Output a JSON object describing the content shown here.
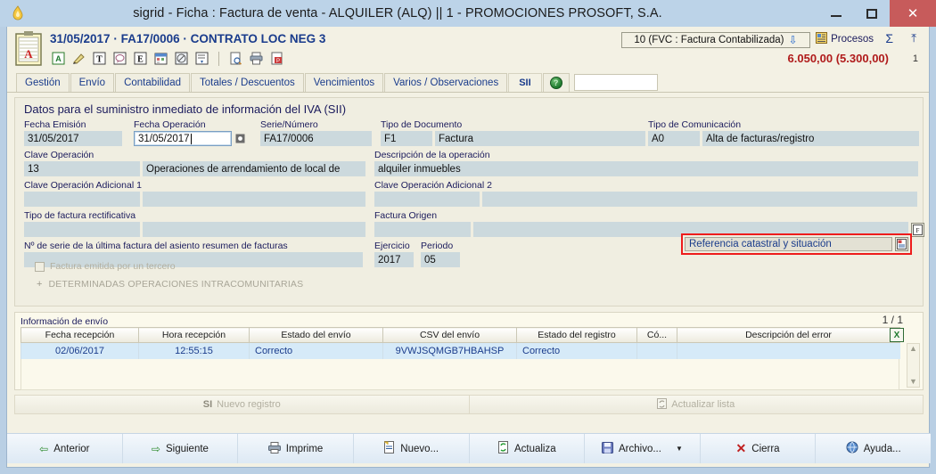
{
  "window": {
    "title": "sigrid - Ficha : Factura de venta - ALQUILER (ALQ) || 1 - PROMOCIONES PROSOFT, S.A.",
    "app_icon": "flame-icon",
    "minimize_label": "–",
    "maximize_label": "□",
    "close_label": "✕"
  },
  "header": {
    "doc_icon": "clipboard-icon",
    "doc_title": "31/05/2017 · FA17/0006 · CONTRATO LOC NEG 3",
    "status_value": "10 (FVC : Factura Contabilizada)",
    "status_arrow": "⇓",
    "procesos_label": "Procesos",
    "sigma_label": "Σ",
    "pin_label": "⤒",
    "amount": "6.050,00 (5.300,00)",
    "amount_count": "1",
    "toolbar_icons": [
      {
        "name": "accent-a-icon",
        "glyph": "A"
      },
      {
        "name": "pencil-icon",
        "glyph": "✎"
      },
      {
        "name": "text-tool-icon",
        "glyph": "T"
      },
      {
        "name": "comment-icon",
        "glyph": "◯"
      },
      {
        "name": "euro-e-icon",
        "glyph": "E"
      },
      {
        "name": "calendar-icon",
        "glyph": "☷"
      },
      {
        "name": "tag-icon",
        "glyph": "⊘"
      },
      {
        "name": "note-icon",
        "glyph": "⌸"
      },
      {
        "name": "preview-icon",
        "glyph": "❐"
      },
      {
        "name": "print-icon",
        "glyph": "⎙"
      },
      {
        "name": "pdf-icon",
        "glyph": "❑"
      }
    ]
  },
  "tabs": [
    {
      "label": "Gestión",
      "active": false
    },
    {
      "label": "Envío",
      "active": false
    },
    {
      "label": "Contabilidad",
      "active": false
    },
    {
      "label": "Totales / Descuentos",
      "active": false
    },
    {
      "label": "Vencimientos",
      "active": false
    },
    {
      "label": "Varios / Observaciones",
      "active": false
    },
    {
      "label": "SII",
      "active": true
    }
  ],
  "tab_help_icon": "help-icon",
  "tab_input_value": "",
  "sii": {
    "panel_title": "Datos para el suministro inmediato de información del IVA (SII)",
    "fecha_emision_label": "Fecha Emisión",
    "fecha_emision_value": "31/05/2017",
    "fecha_operacion_label": "Fecha Operación",
    "fecha_operacion_value": "31/05/2017",
    "fecha_operacion_picker_icon": "calendar-picker-icon",
    "serie_numero_label": "Serie/Número",
    "serie_numero_value": "FA17/0006",
    "tipo_documento_label": "Tipo de Documento",
    "tipo_documento_code": "F1",
    "tipo_documento_value": "Factura",
    "tipo_comunicacion_label": "Tipo de Comunicación",
    "tipo_comunicacion_code": "A0",
    "tipo_comunicacion_value": "Alta de facturas/registro",
    "clave_operacion_label": "Clave Operación",
    "clave_operacion_code": "13",
    "clave_operacion_value": "Operaciones de arrendamiento de local de",
    "descripcion_operacion_label": "Descripción de la operación",
    "descripcion_operacion_value": "alquiler inmuebles",
    "clave_adicional_1_label": "Clave Operación Adicional 1",
    "clave_adicional_1_code": "",
    "clave_adicional_1_value": "",
    "clave_adicional_2_label": "Clave Operación Adicional 2",
    "clave_adicional_2_code": "",
    "clave_adicional_2_value": "",
    "tipo_rectificativa_label": "Tipo de factura rectificativa",
    "tipo_rectificativa_code": "",
    "tipo_rectificativa_value": "",
    "factura_origen_label": "Factura Origen",
    "factura_origen_code": "",
    "factura_origen_value": "",
    "factura_origen_btn_icon": "invoice-lookup-icon",
    "nserie_label": "Nº de serie de la última factura del asiento resumen de facturas",
    "nserie_value": "",
    "ejercicio_label": "Ejercicio",
    "ejercicio_value": "2017",
    "periodo_label": "Periodo",
    "periodo_value": "05",
    "tercero_checkbox_label": "Factura emitida por un tercero",
    "tercero_checked": false,
    "intracomunitarias_label": "DETERMINADAS OPERACIONES INTRACOMUNITARIAS",
    "intracomunitarias_expander": "+",
    "referencia_catastral_value": "Referencia catastral y situación",
    "referencia_catastral_btn_icon": "document-lookup-icon",
    "highlight_color": "#ee1c1c"
  },
  "envio": {
    "title": "Información de envío",
    "count": "1 / 1",
    "export_icon": "excel-export-icon",
    "scroll_up_icon": "chevron-up-icon",
    "scroll_down_icon": "chevron-down-icon",
    "columns": [
      "Fecha recepción",
      "Hora recepción",
      "Estado del envío",
      "CSV del envío",
      "Estado del registro",
      "Có...",
      "Descripción del error"
    ],
    "rows": [
      {
        "fecha_recepcion": "02/06/2017",
        "hora_recepcion": "12:55:15",
        "estado_envio": "Correcto",
        "csv_envio": "9VWJSQMGB7HBAHSP",
        "estado_registro": "Correcto",
        "codigo": "",
        "descripcion_error": ""
      }
    ]
  },
  "actions": [
    {
      "label": "Nuevo registro",
      "icon": "si-icon",
      "icon_glyph": "SI"
    },
    {
      "label": "Actualizar lista",
      "icon": "refresh-doc-icon",
      "icon_glyph": "↻"
    }
  ],
  "bottom_buttons": [
    {
      "label": "Anterior",
      "icon": "arrow-left-icon",
      "glyph": "⇦"
    },
    {
      "label": "Siguiente",
      "icon": "arrow-right-icon",
      "glyph": "⇨"
    },
    {
      "label": "Imprime",
      "icon": "printer-icon",
      "glyph": "⎙"
    },
    {
      "label": "Nuevo...",
      "icon": "new-document-icon",
      "glyph": "❑"
    },
    {
      "label": "Actualiza",
      "icon": "refresh-icon",
      "glyph": "↻"
    },
    {
      "label": "Archivo...",
      "icon": "save-disk-icon",
      "glyph": "▣",
      "has_dropdown": true,
      "dropdown_glyph": "▼"
    },
    {
      "label": "Cierra",
      "icon": "close-x-icon",
      "glyph": "✕"
    },
    {
      "label": "Ayuda...",
      "icon": "help-globe-icon",
      "glyph": "◉"
    }
  ]
}
